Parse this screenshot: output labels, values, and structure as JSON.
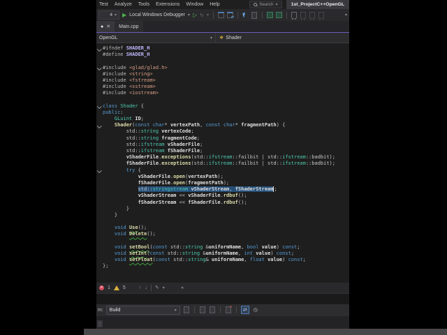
{
  "menubar": {
    "items": [
      "Test",
      "Analyze",
      "Tools",
      "Extensions",
      "Window",
      "Help"
    ],
    "search_label": "Search",
    "window_title": "1st_ProjectC++OpenGL"
  },
  "toolbar": {
    "config_fragment": "4",
    "run_label": "Local Windows Debugger"
  },
  "tabs": {
    "active_dirty_dot": "●",
    "active_close": "✕",
    "main_tab_label": "Main.cpp"
  },
  "navbar": {
    "project": "OpenGL",
    "type_name": "Shader"
  },
  "editor": {
    "lines": [
      {
        "f": 1,
        "s": [
          {
            "c": "pp",
            "t": "#ifndef "
          },
          {
            "c": "mac",
            "t": "SHADER_H"
          }
        ]
      },
      {
        "s": [
          {
            "c": "pp",
            "t": "#define "
          },
          {
            "c": "mac",
            "t": "SHADER_H"
          }
        ]
      },
      {
        "s": []
      },
      {
        "f": 1,
        "s": [
          {
            "c": "pp",
            "t": "#include "
          },
          {
            "c": "str",
            "t": "<glad/glad.h>"
          }
        ]
      },
      {
        "s": [
          {
            "c": "pp",
            "t": "#include "
          },
          {
            "c": "str",
            "t": "<string>"
          }
        ]
      },
      {
        "s": [
          {
            "c": "pp",
            "t": "#include "
          },
          {
            "c": "str",
            "t": "<fstream>"
          }
        ]
      },
      {
        "s": [
          {
            "c": "pp",
            "t": "#include "
          },
          {
            "c": "str",
            "t": "<sstream>"
          }
        ]
      },
      {
        "s": [
          {
            "c": "pp",
            "t": "#include "
          },
          {
            "c": "str",
            "t": "<iostream>"
          }
        ]
      },
      {
        "s": []
      },
      {
        "f": 1,
        "s": [
          {
            "c": "kw",
            "t": "class "
          },
          {
            "c": "ty",
            "t": "Shader"
          },
          {
            "c": "pl",
            "t": " {"
          }
        ]
      },
      {
        "s": [
          {
            "c": "kw",
            "t": "public"
          },
          {
            "c": "pl",
            "t": ":"
          }
        ]
      },
      {
        "s": [
          {
            "c": "pl",
            "t": "    "
          },
          {
            "c": "ty",
            "t": "GLuint"
          },
          {
            "c": "id",
            "t": " ID"
          },
          {
            "c": "pl",
            "t": ";"
          }
        ]
      },
      {
        "f": 1,
        "s": [
          {
            "c": "pl",
            "t": "    "
          },
          {
            "c": "fn",
            "t": "Shader"
          },
          {
            "c": "pl",
            "t": "("
          },
          {
            "c": "kw",
            "t": "const char"
          },
          {
            "c": "pl",
            "t": "* "
          },
          {
            "c": "id",
            "t": "vertexPath"
          },
          {
            "c": "pl",
            "t": ", "
          },
          {
            "c": "kw",
            "t": "const char"
          },
          {
            "c": "pl",
            "t": "* "
          },
          {
            "c": "id",
            "t": "fragmentPath"
          },
          {
            "c": "pl",
            "t": ") {"
          }
        ]
      },
      {
        "s": [
          {
            "c": "pl",
            "t": "        std::"
          },
          {
            "c": "ty",
            "t": "string"
          },
          {
            "c": "id",
            "t": " vertexCode"
          },
          {
            "c": "pl",
            "t": ";"
          }
        ]
      },
      {
        "s": [
          {
            "c": "pl",
            "t": "        std::"
          },
          {
            "c": "ty",
            "t": "string"
          },
          {
            "c": "id",
            "t": " fragmentCode"
          },
          {
            "c": "pl",
            "t": ";"
          }
        ]
      },
      {
        "s": [
          {
            "c": "pl",
            "t": "        std::"
          },
          {
            "c": "ty",
            "t": "ifstream"
          },
          {
            "c": "id",
            "t": " vShaderFile"
          },
          {
            "c": "pl",
            "t": ";"
          }
        ]
      },
      {
        "s": [
          {
            "c": "pl",
            "t": "        std::"
          },
          {
            "c": "ty",
            "t": "ifstream"
          },
          {
            "c": "id",
            "t": " fShaderFile"
          },
          {
            "c": "pl",
            "t": ";"
          }
        ]
      },
      {
        "s": [
          {
            "c": "pl",
            "t": "        "
          },
          {
            "c": "id",
            "t": "vShaderFile"
          },
          {
            "c": "pl",
            "t": "."
          },
          {
            "c": "fn",
            "t": "exceptions"
          },
          {
            "c": "pl",
            "t": "(std::"
          },
          {
            "c": "ty",
            "t": "ifstream"
          },
          {
            "c": "pl",
            "t": "::failbit | std::"
          },
          {
            "c": "ty",
            "t": "ifstream"
          },
          {
            "c": "pl",
            "t": "::badbit);"
          }
        ]
      },
      {
        "s": [
          {
            "c": "pl",
            "t": "        "
          },
          {
            "c": "id",
            "t": "fShaderFile"
          },
          {
            "c": "pl",
            "t": "."
          },
          {
            "c": "fn",
            "t": "exceptions"
          },
          {
            "c": "pl",
            "t": "(std::"
          },
          {
            "c": "ty",
            "t": "ifstream"
          },
          {
            "c": "pl",
            "t": "::failbit | std::"
          },
          {
            "c": "ty",
            "t": "ifstream"
          },
          {
            "c": "pl",
            "t": "::badbit);"
          }
        ]
      },
      {
        "f": 1,
        "s": [
          {
            "c": "pl",
            "t": "        "
          },
          {
            "c": "kw",
            "t": "try"
          },
          {
            "c": "pl",
            "t": " {"
          }
        ]
      },
      {
        "s": [
          {
            "c": "pl",
            "t": "            "
          },
          {
            "c": "id",
            "t": "vShaderFile"
          },
          {
            "c": "pl",
            "t": "."
          },
          {
            "c": "fn",
            "t": "open"
          },
          {
            "c": "pl",
            "t": "("
          },
          {
            "c": "id",
            "t": "vertexPath"
          },
          {
            "c": "pl",
            "t": ");"
          }
        ]
      },
      {
        "s": [
          {
            "c": "pl",
            "t": "            "
          },
          {
            "c": "id",
            "t": "fShaderFile"
          },
          {
            "c": "pl",
            "t": "."
          },
          {
            "c": "fn",
            "t": "open"
          },
          {
            "c": "pl",
            "t": "("
          },
          {
            "c": "id",
            "t": "fragmentPath"
          },
          {
            "c": "pl",
            "t": ");"
          }
        ]
      },
      {
        "s": [
          {
            "c": "pl",
            "t": "            "
          },
          {
            "c": "pl",
            "t": "std::",
            "sel": 1
          },
          {
            "c": "ty",
            "t": "stringstream",
            "sel": 1
          },
          {
            "c": "id",
            "t": " vShaderStream",
            "sel": 1
          },
          {
            "c": "pl",
            "t": ", ",
            "sel": 1
          },
          {
            "c": "id",
            "t": "fShaderStream",
            "sel": 1
          },
          {
            "caret": 1
          },
          {
            "c": "pl",
            "t": ";"
          }
        ]
      },
      {
        "s": [
          {
            "c": "pl",
            "t": "            "
          },
          {
            "c": "id",
            "t": "vShaderStream"
          },
          {
            "c": "pl",
            "t": " << "
          },
          {
            "c": "id",
            "t": "vShaderFile"
          },
          {
            "c": "pl",
            "t": "."
          },
          {
            "c": "fn",
            "t": "rdbuf"
          },
          {
            "c": "pl",
            "t": "();"
          }
        ]
      },
      {
        "s": [
          {
            "c": "pl",
            "t": "            "
          },
          {
            "c": "id",
            "t": "fShaderStream"
          },
          {
            "c": "pl",
            "t": " << "
          },
          {
            "c": "id",
            "t": "fShaderFile"
          },
          {
            "c": "pl",
            "t": "."
          },
          {
            "c": "fn",
            "t": "rdbuf"
          },
          {
            "c": "pl",
            "t": "();"
          }
        ]
      },
      {
        "s": [
          {
            "c": "pl",
            "t": "        }"
          }
        ]
      },
      {
        "s": [
          {
            "c": "pl",
            "t": "    }"
          }
        ]
      },
      {
        "s": []
      },
      {
        "s": [
          {
            "c": "pl",
            "t": "    "
          },
          {
            "c": "kw",
            "t": "void"
          },
          {
            "c": "pl",
            "t": " "
          },
          {
            "c": "fnq",
            "t": "Use"
          },
          {
            "c": "pl",
            "t": "();"
          }
        ]
      },
      {
        "s": [
          {
            "c": "pl",
            "t": "    "
          },
          {
            "c": "kw",
            "t": "void"
          },
          {
            "c": "pl",
            "t": " "
          },
          {
            "c": "fnq",
            "t": "Delete"
          },
          {
            "c": "pl",
            "t": "();"
          }
        ]
      },
      {
        "s": []
      },
      {
        "s": [
          {
            "c": "pl",
            "t": "    "
          },
          {
            "c": "kw",
            "t": "void"
          },
          {
            "c": "pl",
            "t": " "
          },
          {
            "c": "fnq",
            "t": "setBool"
          },
          {
            "c": "pl",
            "t": "("
          },
          {
            "c": "kw",
            "t": "const"
          },
          {
            "c": "pl",
            "t": " std::"
          },
          {
            "c": "ty",
            "t": "string"
          },
          {
            "c": "pl",
            "t": " &"
          },
          {
            "c": "id",
            "t": "uniformName"
          },
          {
            "c": "pl",
            "t": ", "
          },
          {
            "c": "kw",
            "t": "bool"
          },
          {
            "c": "id",
            "t": " value"
          },
          {
            "c": "pl",
            "t": ") "
          },
          {
            "c": "kw",
            "t": "const"
          },
          {
            "c": "pl",
            "t": ";"
          }
        ]
      },
      {
        "s": [
          {
            "c": "pl",
            "t": "    "
          },
          {
            "c": "kw",
            "t": "void"
          },
          {
            "c": "pl",
            "t": " "
          },
          {
            "c": "fnq",
            "t": "setInt"
          },
          {
            "c": "pl",
            "t": "("
          },
          {
            "c": "kw",
            "t": "const"
          },
          {
            "c": "pl",
            "t": " std::"
          },
          {
            "c": "ty",
            "t": "string"
          },
          {
            "c": "pl",
            "t": " &"
          },
          {
            "c": "id",
            "t": "uniformName"
          },
          {
            "c": "pl",
            "t": ", "
          },
          {
            "c": "kw",
            "t": "int"
          },
          {
            "c": "id",
            "t": " value"
          },
          {
            "c": "pl",
            "t": ") "
          },
          {
            "c": "kw",
            "t": "const"
          },
          {
            "c": "pl",
            "t": ";"
          }
        ]
      },
      {
        "s": [
          {
            "c": "pl",
            "t": "    "
          },
          {
            "c": "kw",
            "t": "void"
          },
          {
            "c": "pl",
            "t": " "
          },
          {
            "c": "fnq",
            "t": "setFloat"
          },
          {
            "c": "pl",
            "t": "("
          },
          {
            "c": "kw",
            "t": "const"
          },
          {
            "c": "pl",
            "t": " std::"
          },
          {
            "c": "ty",
            "t": "string"
          },
          {
            "c": "pl",
            "t": "& "
          },
          {
            "c": "id",
            "t": "uniformName"
          },
          {
            "c": "pl",
            "t": ", "
          },
          {
            "c": "kw",
            "t": "float"
          },
          {
            "c": "id",
            "t": " value"
          },
          {
            "c": "pl",
            "t": ") "
          },
          {
            "c": "kw",
            "t": "const"
          },
          {
            "c": "pl",
            "t": ";"
          }
        ]
      },
      {
        "s": [
          {
            "c": "pl",
            "t": "};"
          }
        ]
      }
    ]
  },
  "indicator_bar": {
    "error_count": "1",
    "warning_count": "5"
  },
  "output_panel": {
    "from_label_fragment": "m:",
    "source_value": "Build"
  },
  "icons": {
    "run_play": "▶",
    "start_without_debugging": "▷",
    "hot_reload": "↻",
    "dropdown": "▾",
    "up_arrow": "↑",
    "down_arrow": "↓",
    "scroll_left": "◂",
    "clock": "◷",
    "class_glyph": "❖",
    "error_x": "✕",
    "grip_dots": "⋮"
  },
  "colors": {
    "accent_purple": "#6e5cb8",
    "selection_blue": "#264f78",
    "error_red": "#d64a5a",
    "warning_yellow": "#d9b13b",
    "run_green": "#4db24d",
    "editor_bg": "#1e1e1e"
  }
}
